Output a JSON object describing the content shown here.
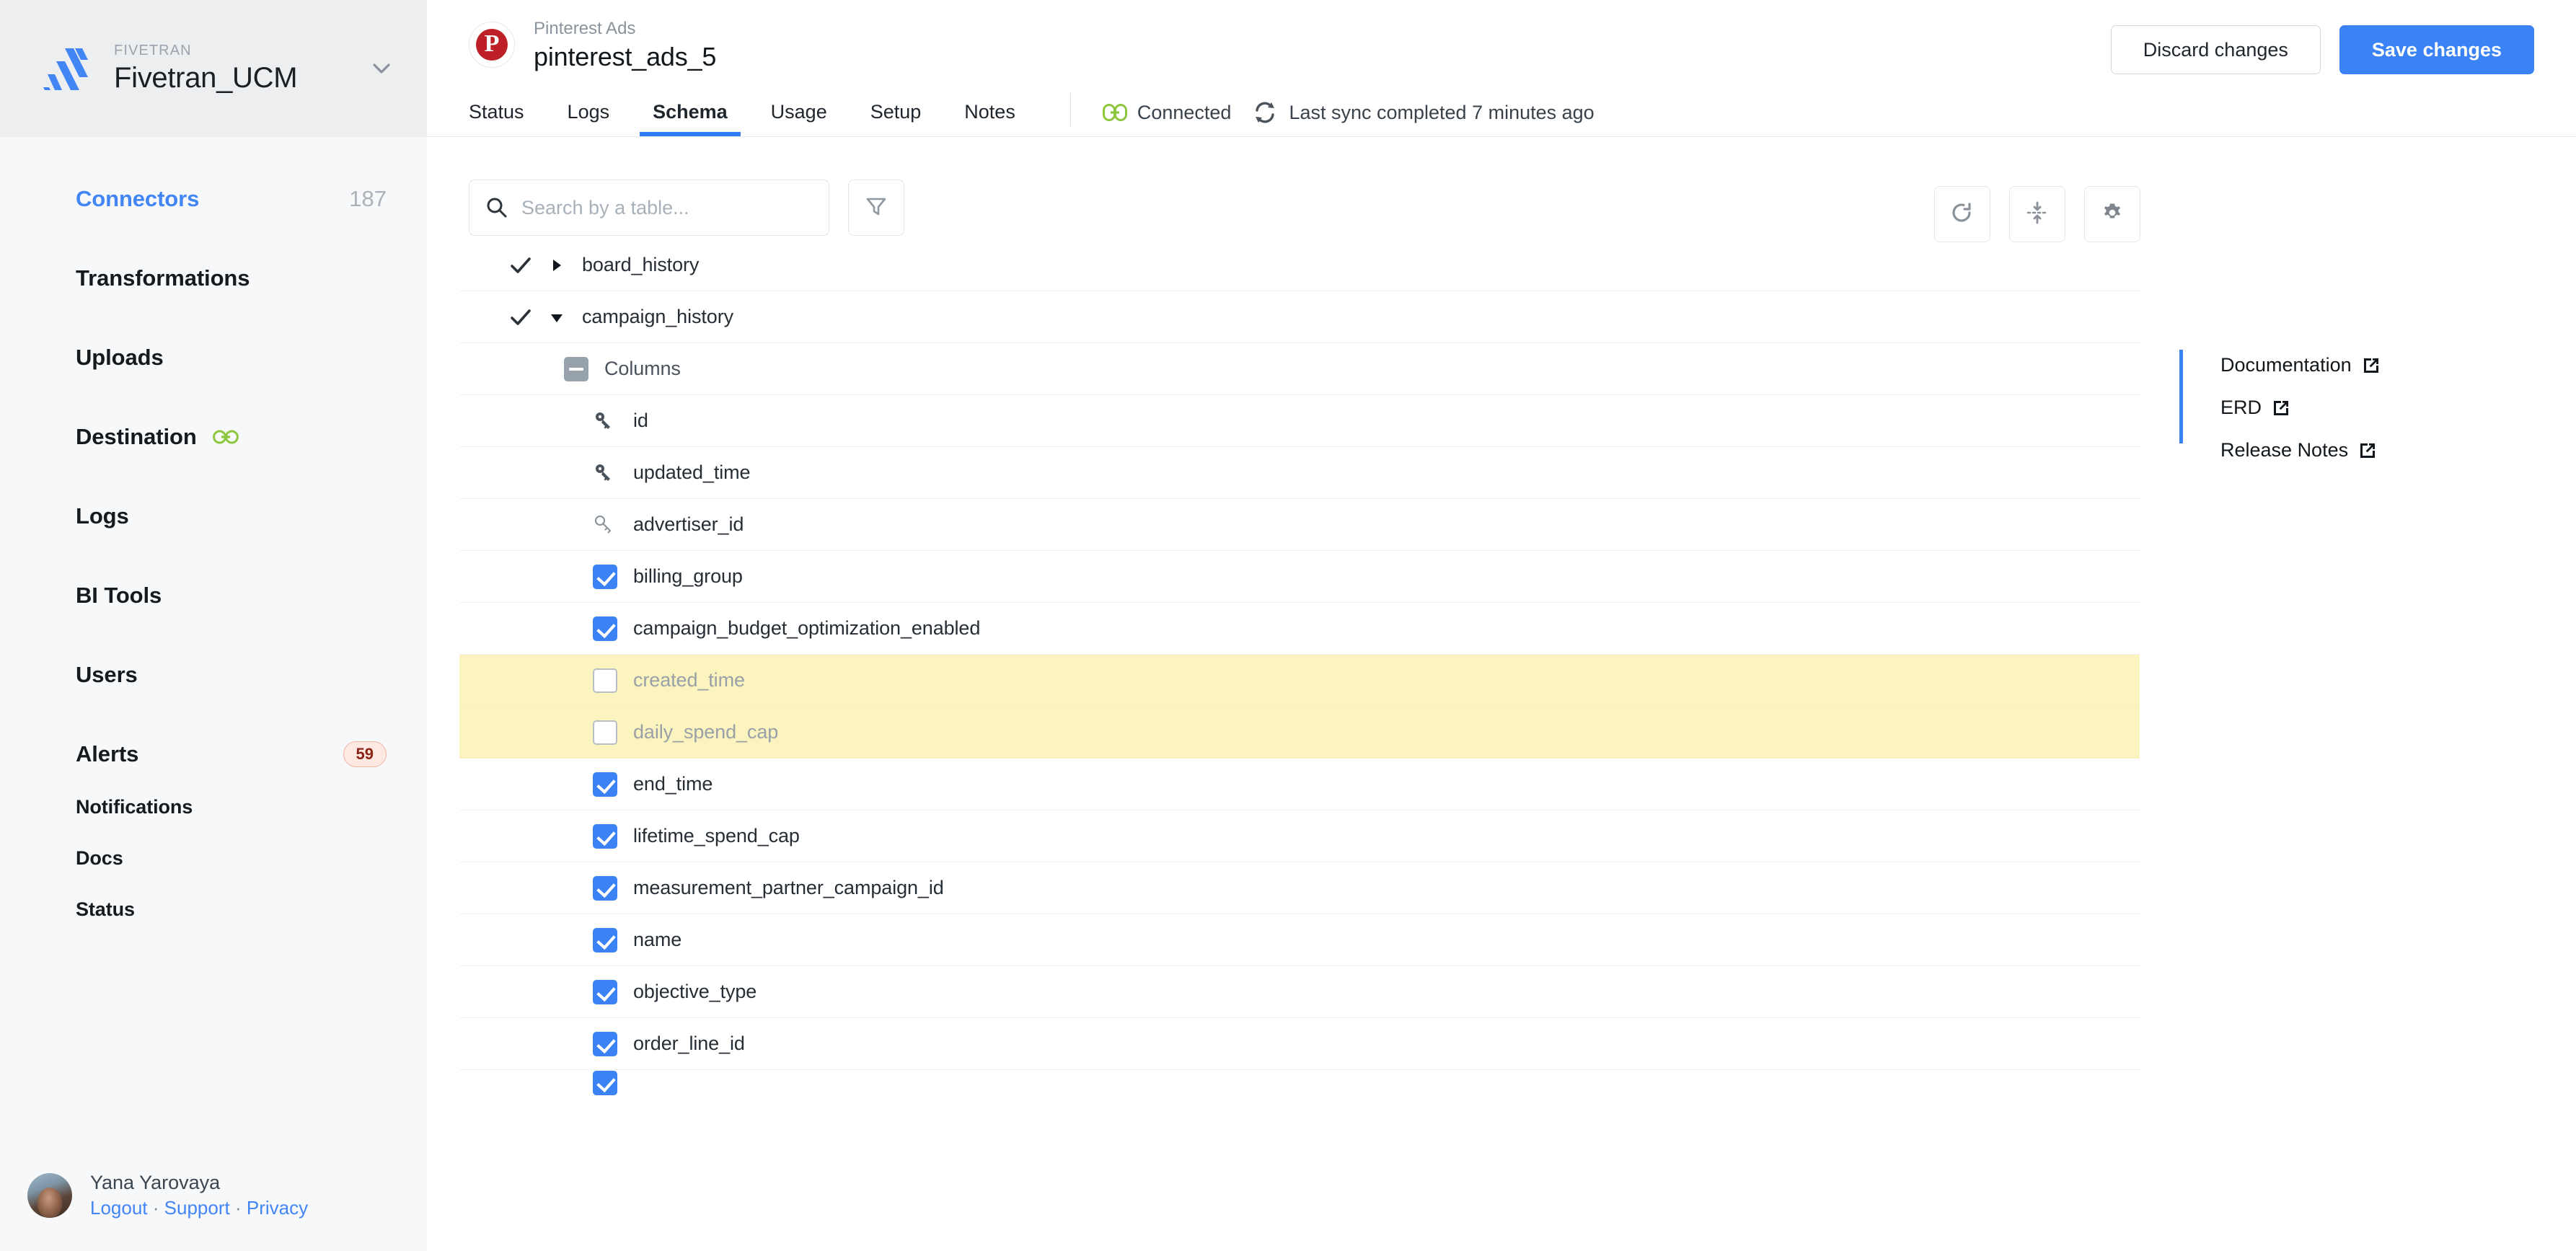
{
  "sidebar": {
    "brand": {
      "kicker": "FIVETRAN",
      "name": "Fivetran_UCM"
    },
    "nav": [
      {
        "label": "Connectors",
        "count": "187",
        "active": true
      },
      {
        "label": "Transformations"
      },
      {
        "label": "Uploads"
      },
      {
        "label": "Destination",
        "icon": "link-icon"
      },
      {
        "label": "Logs"
      },
      {
        "label": "BI Tools"
      },
      {
        "label": "Users"
      },
      {
        "label": "Alerts",
        "badge": "59"
      }
    ],
    "sub_items": [
      {
        "label": "Notifications"
      },
      {
        "label": "Docs"
      },
      {
        "label": "Status"
      }
    ],
    "user": {
      "name": "Yana Yarovaya",
      "logout": "Logout",
      "support": "Support",
      "privacy": "Privacy",
      "separator": "·"
    }
  },
  "header": {
    "connector_kicker": "Pinterest Ads",
    "connector_name": "pinterest_ads_5",
    "logo_letter": "P",
    "tabs": [
      {
        "label": "Status",
        "active": false
      },
      {
        "label": "Logs",
        "active": false
      },
      {
        "label": "Schema",
        "active": true
      },
      {
        "label": "Usage",
        "active": false
      },
      {
        "label": "Setup",
        "active": false
      },
      {
        "label": "Notes",
        "active": false
      }
    ],
    "status_text": "Connected",
    "sync_text": "Last sync completed 7 minutes ago",
    "discard_label": "Discard changes",
    "save_label": "Save changes"
  },
  "toolbar": {
    "search_placeholder": "Search by a table...",
    "search_value": "",
    "filter_icon": "funnel-icon",
    "refresh_icon": "refresh-icon",
    "collapse_icon": "collapse-all-icon",
    "settings_icon": "gear-icon"
  },
  "schema": {
    "rows": [
      {
        "kind": "table",
        "label": "board_history",
        "checked": true,
        "expanded": false,
        "highlight": false
      },
      {
        "kind": "table",
        "label": "campaign_history",
        "checked": true,
        "expanded": true,
        "highlight": false
      },
      {
        "kind": "group",
        "label": "Columns",
        "state": "indeterminate",
        "highlight": false
      },
      {
        "kind": "column",
        "label": "id",
        "icon": "primary-key-icon",
        "highlight": false
      },
      {
        "kind": "column",
        "label": "updated_time",
        "icon": "primary-key-icon",
        "highlight": false
      },
      {
        "kind": "column",
        "label": "advertiser_id",
        "icon": "foreign-key-icon",
        "highlight": false
      },
      {
        "kind": "column",
        "label": "billing_group",
        "state": "checked",
        "highlight": false
      },
      {
        "kind": "column",
        "label": "campaign_budget_optimization_enabled",
        "state": "checked",
        "highlight": false
      },
      {
        "kind": "column",
        "label": "created_time",
        "state": "unchecked",
        "highlight": true
      },
      {
        "kind": "column",
        "label": "daily_spend_cap",
        "state": "unchecked",
        "highlight": true
      },
      {
        "kind": "column",
        "label": "end_time",
        "state": "checked",
        "highlight": false
      },
      {
        "kind": "column",
        "label": "lifetime_spend_cap",
        "state": "checked",
        "highlight": false
      },
      {
        "kind": "column",
        "label": "measurement_partner_campaign_id",
        "state": "checked",
        "highlight": false
      },
      {
        "kind": "column",
        "label": "name",
        "state": "checked",
        "highlight": false
      },
      {
        "kind": "column",
        "label": "objective_type",
        "state": "checked",
        "highlight": false
      },
      {
        "kind": "column",
        "label": "order_line_id",
        "state": "checked",
        "highlight": false
      },
      {
        "kind": "column",
        "label": "",
        "state": "checked",
        "highlight": false,
        "clipped": true
      }
    ]
  },
  "info_panel": {
    "links": [
      {
        "label": "Documentation",
        "icon": "external-link-icon"
      },
      {
        "label": "ERD",
        "icon": "external-link-icon"
      },
      {
        "label": "Release Notes",
        "icon": "external-link-icon"
      }
    ]
  },
  "colors": {
    "accent_blue": "#3b82f5",
    "link_blue": "#4285f4",
    "highlight_yellow": "#fbf4bf",
    "connected_green": "#8dc63f",
    "pinterest_red": "#bd2026",
    "badge_bg": "#fde8e2",
    "badge_text": "#8b2415"
  }
}
